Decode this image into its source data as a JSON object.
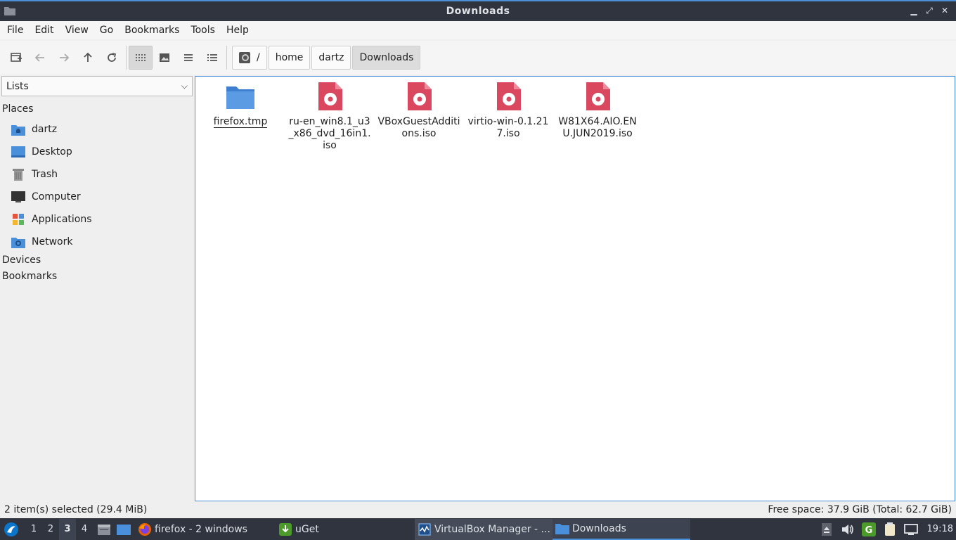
{
  "window": {
    "title": "Downloads"
  },
  "menubar": [
    "File",
    "Edit",
    "View",
    "Go",
    "Bookmarks",
    "Tools",
    "Help"
  ],
  "path": {
    "root": "/",
    "segments": [
      "home",
      "dartz",
      "Downloads"
    ]
  },
  "sidebar": {
    "selector": "Lists",
    "places_header": "Places",
    "places": [
      {
        "label": "dartz",
        "icon": "home-folder-icon"
      },
      {
        "label": "Desktop",
        "icon": "desktop-icon"
      },
      {
        "label": "Trash",
        "icon": "trash-icon"
      },
      {
        "label": "Computer",
        "icon": "computer-icon"
      },
      {
        "label": "Applications",
        "icon": "applications-icon"
      },
      {
        "label": "Network",
        "icon": "network-icon"
      }
    ],
    "devices_header": "Devices",
    "bookmarks_header": "Bookmarks"
  },
  "files": [
    {
      "name": "firefox.tmp",
      "type": "folder"
    },
    {
      "name": "ru-en_win8.1_u3_x86_dvd_16in1.iso",
      "type": "iso"
    },
    {
      "name": "VBoxGuestAdditions.iso",
      "type": "iso"
    },
    {
      "name": "virtio-win-0.1.217.iso",
      "type": "iso"
    },
    {
      "name": "W81X64.AIO.ENU.JUN2019.iso",
      "type": "iso"
    }
  ],
  "status": {
    "selection": "2 item(s) selected (29.4 MiB)",
    "free_space": "Free space: 37.9 GiB (Total: 62.7 GiB)"
  },
  "taskbar": {
    "workspaces": [
      "1",
      "2",
      "3",
      "4"
    ],
    "active_workspace": "3",
    "tasks": [
      {
        "label": "firefox - 2 windows",
        "icon": "firefox-icon"
      },
      {
        "label": "uGet",
        "icon": "uget-icon"
      },
      {
        "label": "VirtualBox Manager - ...",
        "icon": "virtualbox-icon"
      },
      {
        "label": "Downloads",
        "icon": "folder-icon"
      }
    ],
    "clock": "19:18"
  },
  "colors": {
    "accent": "#4a90d9",
    "titlebar": "#2f343f",
    "iso": "#d9485f",
    "folder": "#4a8fd9"
  }
}
